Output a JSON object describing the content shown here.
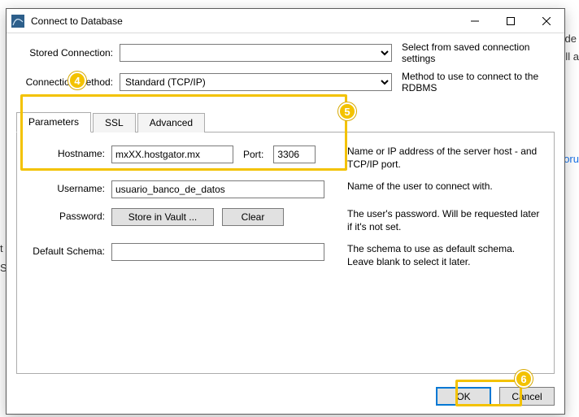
{
  "dialog": {
    "title": "Connect to Database",
    "stored_connection_label": "Stored Connection:",
    "stored_connection_hint": "Select from saved connection settings",
    "connection_method_label": "Connection Method:",
    "connection_method_value": "Standard (TCP/IP)",
    "connection_method_hint": "Method to use to connect to the RDBMS",
    "tabs": {
      "parameters": "Parameters",
      "ssl": "SSL",
      "advanced": "Advanced"
    },
    "form": {
      "hostname_label": "Hostname:",
      "hostname_value": "mxXX.hostgator.mx",
      "port_label": "Port:",
      "port_value": "3306",
      "hostname_hint": "Name or IP address of the server host - and TCP/IP port.",
      "username_label": "Username:",
      "username_value": "usuario_banco_de_datos",
      "username_hint": "Name of the user to connect with.",
      "password_label": "Password:",
      "store_in_vault": "Store in Vault ...",
      "clear": "Clear",
      "password_hint": "The user's password. Will be requested later if it's not set.",
      "default_schema_label": "Default Schema:",
      "default_schema_hint": "The schema to use as default schema. Leave blank to select it later."
    },
    "buttons": {
      "ok": "OK",
      "cancel": "Cancel"
    }
  },
  "annotations": {
    "b4": "4",
    "b5": "5",
    "b6": "6"
  },
  "background": {
    "t1": "de",
    "t2": "ell a",
    "t3": "oru",
    "l1": "t",
    "l2": "S"
  }
}
